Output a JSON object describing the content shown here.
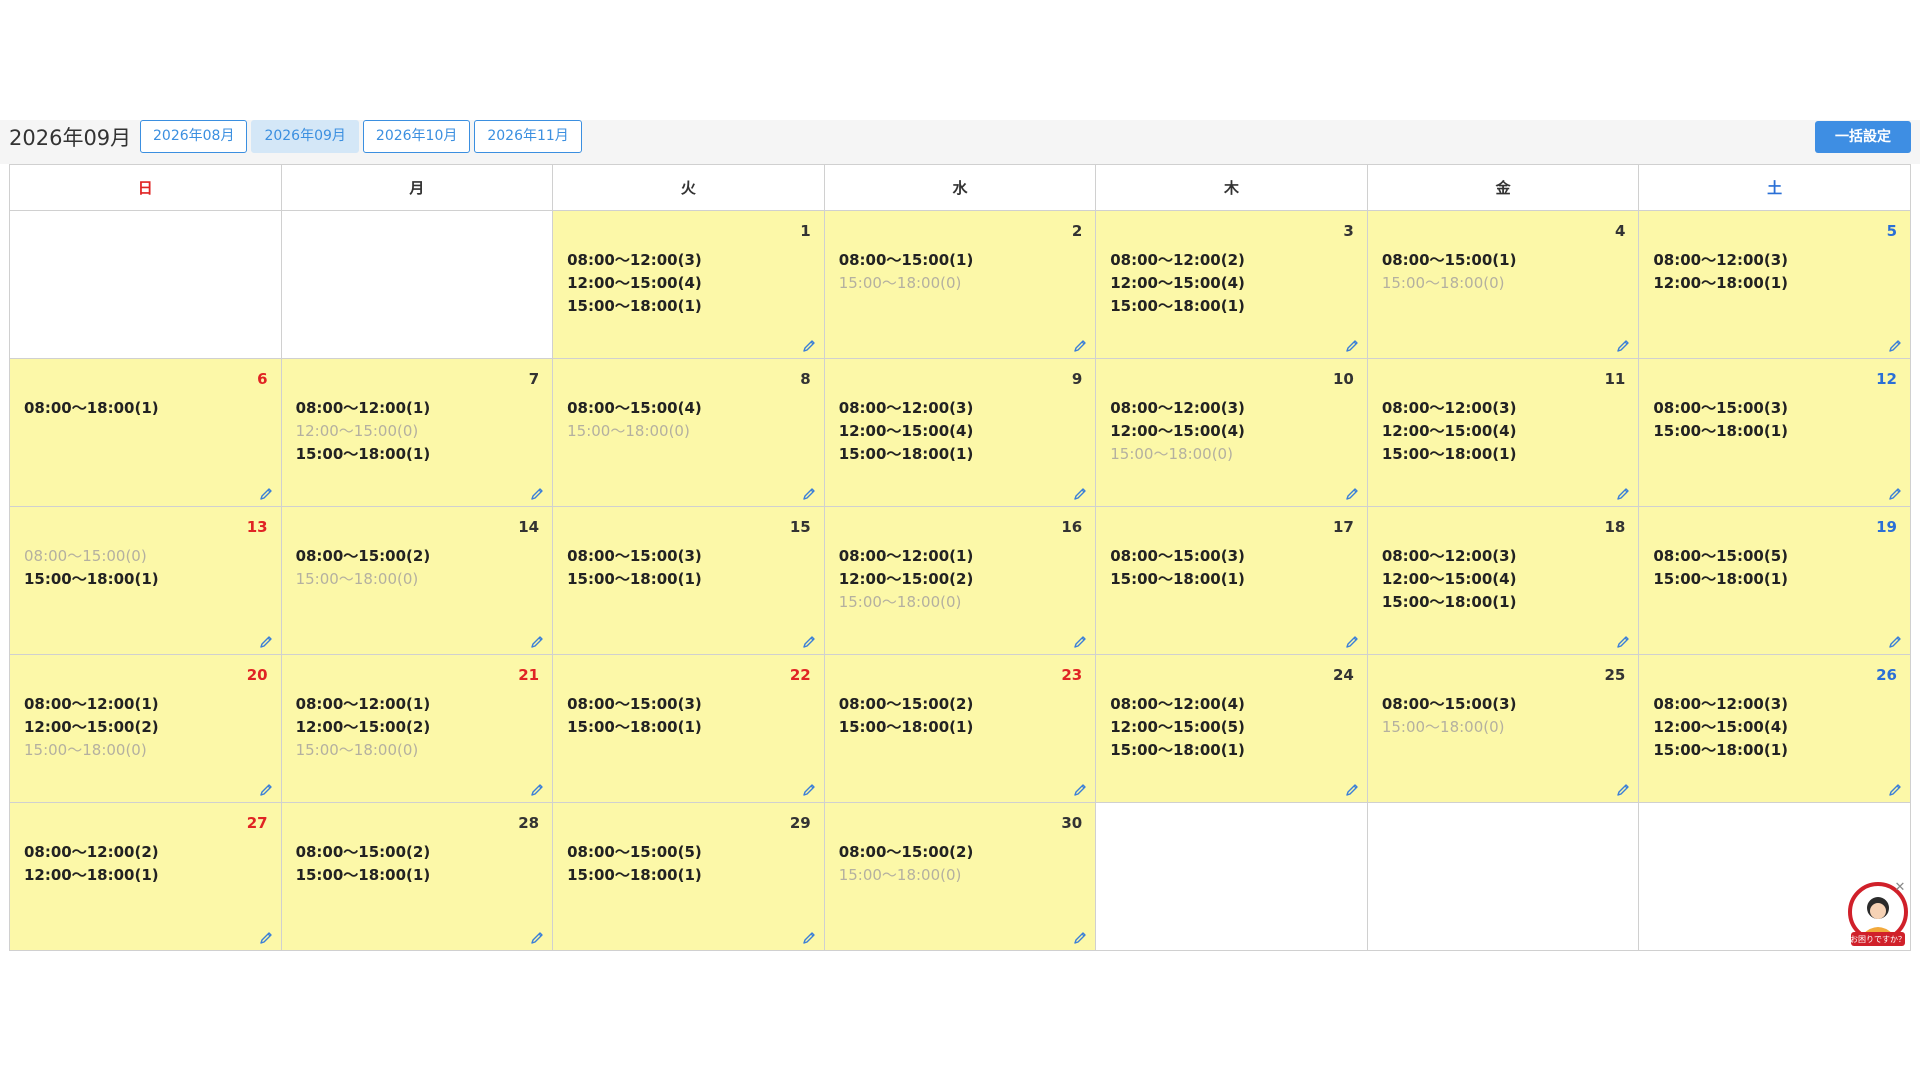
{
  "header": {
    "month_title": "2026年09月",
    "month_tabs": [
      {
        "label": "2026年08月",
        "active": false
      },
      {
        "label": "2026年09月",
        "active": true
      },
      {
        "label": "2026年10月",
        "active": false
      },
      {
        "label": "2026年11月",
        "active": false
      }
    ],
    "bulk_button_label": "一括設定"
  },
  "weekdays": [
    {
      "label": "日",
      "color": "red"
    },
    {
      "label": "月",
      "color": "normal"
    },
    {
      "label": "火",
      "color": "normal"
    },
    {
      "label": "水",
      "color": "normal"
    },
    {
      "label": "木",
      "color": "normal"
    },
    {
      "label": "金",
      "color": "normal"
    },
    {
      "label": "土",
      "color": "blue"
    }
  ],
  "weeks": [
    [
      null,
      null,
      {
        "day": "1",
        "color": "normal",
        "slots": [
          "08:00～12:00(3)",
          "12:00～15:00(4)",
          "15:00～18:00(1)"
        ]
      },
      {
        "day": "2",
        "color": "normal",
        "slots": [
          "08:00～15:00(1)",
          "15:00～18:00(0)"
        ]
      },
      {
        "day": "3",
        "color": "normal",
        "slots": [
          "08:00～12:00(2)",
          "12:00～15:00(4)",
          "15:00～18:00(1)"
        ]
      },
      {
        "day": "4",
        "color": "normal",
        "slots": [
          "08:00～15:00(1)",
          "15:00～18:00(0)"
        ]
      },
      {
        "day": "5",
        "color": "blue",
        "slots": [
          "08:00～12:00(3)",
          "12:00～18:00(1)"
        ]
      }
    ],
    [
      {
        "day": "6",
        "color": "red",
        "slots": [
          "08:00～18:00(1)"
        ]
      },
      {
        "day": "7",
        "color": "normal",
        "slots": [
          "08:00～12:00(1)",
          "12:00～15:00(0)",
          "15:00～18:00(1)"
        ]
      },
      {
        "day": "8",
        "color": "normal",
        "slots": [
          "08:00～15:00(4)",
          "15:00～18:00(0)"
        ]
      },
      {
        "day": "9",
        "color": "normal",
        "slots": [
          "08:00～12:00(3)",
          "12:00～15:00(4)",
          "15:00～18:00(1)"
        ]
      },
      {
        "day": "10",
        "color": "normal",
        "slots": [
          "08:00～12:00(3)",
          "12:00～15:00(4)",
          "15:00～18:00(0)"
        ]
      },
      {
        "day": "11",
        "color": "normal",
        "slots": [
          "08:00～12:00(3)",
          "12:00～15:00(4)",
          "15:00～18:00(1)"
        ]
      },
      {
        "day": "12",
        "color": "blue",
        "slots": [
          "08:00～15:00(3)",
          "15:00～18:00(1)"
        ]
      }
    ],
    [
      {
        "day": "13",
        "color": "red",
        "slots": [
          "08:00～15:00(0)",
          "15:00～18:00(1)"
        ]
      },
      {
        "day": "14",
        "color": "normal",
        "slots": [
          "08:00～15:00(2)",
          "15:00～18:00(0)"
        ]
      },
      {
        "day": "15",
        "color": "normal",
        "slots": [
          "08:00～15:00(3)",
          "15:00～18:00(1)"
        ]
      },
      {
        "day": "16",
        "color": "normal",
        "slots": [
          "08:00～12:00(1)",
          "12:00～15:00(2)",
          "15:00～18:00(0)"
        ]
      },
      {
        "day": "17",
        "color": "normal",
        "slots": [
          "08:00～15:00(3)",
          "15:00～18:00(1)"
        ]
      },
      {
        "day": "18",
        "color": "normal",
        "slots": [
          "08:00～12:00(3)",
          "12:00～15:00(4)",
          "15:00～18:00(1)"
        ]
      },
      {
        "day": "19",
        "color": "blue",
        "slots": [
          "08:00～15:00(5)",
          "15:00～18:00(1)"
        ]
      }
    ],
    [
      {
        "day": "20",
        "color": "red",
        "slots": [
          "08:00～12:00(1)",
          "12:00～15:00(2)",
          "15:00～18:00(0)"
        ]
      },
      {
        "day": "21",
        "color": "red",
        "slots": [
          "08:00～12:00(1)",
          "12:00～15:00(2)",
          "15:00～18:00(0)"
        ]
      },
      {
        "day": "22",
        "color": "red",
        "slots": [
          "08:00～15:00(3)",
          "15:00～18:00(1)"
        ]
      },
      {
        "day": "23",
        "color": "red",
        "slots": [
          "08:00～15:00(2)",
          "15:00～18:00(1)"
        ]
      },
      {
        "day": "24",
        "color": "normal",
        "slots": [
          "08:00～12:00(4)",
          "12:00～15:00(5)",
          "15:00～18:00(1)"
        ]
      },
      {
        "day": "25",
        "color": "normal",
        "slots": [
          "08:00～15:00(3)",
          "15:00～18:00(0)"
        ]
      },
      {
        "day": "26",
        "color": "blue",
        "slots": [
          "08:00～12:00(3)",
          "12:00～15:00(4)",
          "15:00～18:00(1)"
        ]
      }
    ],
    [
      {
        "day": "27",
        "color": "red",
        "slots": [
          "08:00～12:00(2)",
          "12:00～18:00(1)"
        ]
      },
      {
        "day": "28",
        "color": "normal",
        "slots": [
          "08:00～15:00(2)",
          "15:00～18:00(1)"
        ]
      },
      {
        "day": "29",
        "color": "normal",
        "slots": [
          "08:00～15:00(5)",
          "15:00～18:00(1)"
        ]
      },
      {
        "day": "30",
        "color": "normal",
        "slots": [
          "08:00～15:00(2)",
          "15:00～18:00(0)"
        ]
      },
      null,
      null,
      null
    ]
  ],
  "icons": {
    "edit": "pencil-icon",
    "help": "help-avatar-icon",
    "close": "close-icon"
  },
  "help_widget": {
    "label": "お困りですか？"
  },
  "colors": {
    "accent": "#3e8ee3",
    "cell_available": "#fcf8a8",
    "holiday_red": "#e02424",
    "saturday_blue": "#2a6fd6",
    "zero_slot_gray": "#b4b0a0"
  }
}
